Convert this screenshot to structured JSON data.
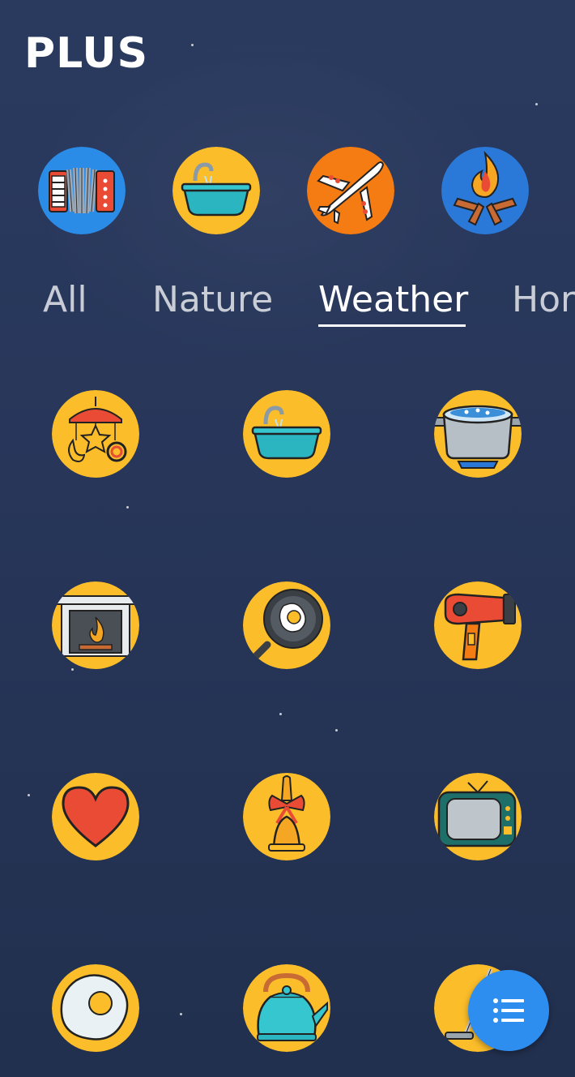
{
  "app": {
    "title": "PLUS"
  },
  "featured": [
    {
      "icon": "accordion-icon",
      "bg": "#2a8ce6"
    },
    {
      "icon": "bathtub-icon",
      "bg": "#fbbd2a"
    },
    {
      "icon": "airplane-icon",
      "bg": "#f57c12"
    },
    {
      "icon": "campfire-icon",
      "bg": "#2a78d8"
    }
  ],
  "tabs": [
    {
      "label": "All"
    },
    {
      "label": "Nature"
    },
    {
      "label": "Weather",
      "active": true
    },
    {
      "label": "Hor"
    }
  ],
  "sounds": [
    {
      "icon": "baby-mobile-icon"
    },
    {
      "icon": "bathtub-icon"
    },
    {
      "icon": "boiling-pot-icon"
    },
    {
      "icon": "fireplace-icon"
    },
    {
      "icon": "frying-egg-pan-icon"
    },
    {
      "icon": "hair-dryer-icon"
    },
    {
      "icon": "heart-icon"
    },
    {
      "icon": "bell-icon"
    },
    {
      "icon": "tv-icon"
    },
    {
      "icon": "fried-egg-icon"
    },
    {
      "icon": "kettle-icon"
    },
    {
      "icon": "vacuum-icon"
    }
  ],
  "fab": {
    "icon": "list-icon",
    "color": "#2d8ef0"
  },
  "colors": {
    "icon_yellow": "#fbbd2a",
    "background": "#27365a"
  }
}
